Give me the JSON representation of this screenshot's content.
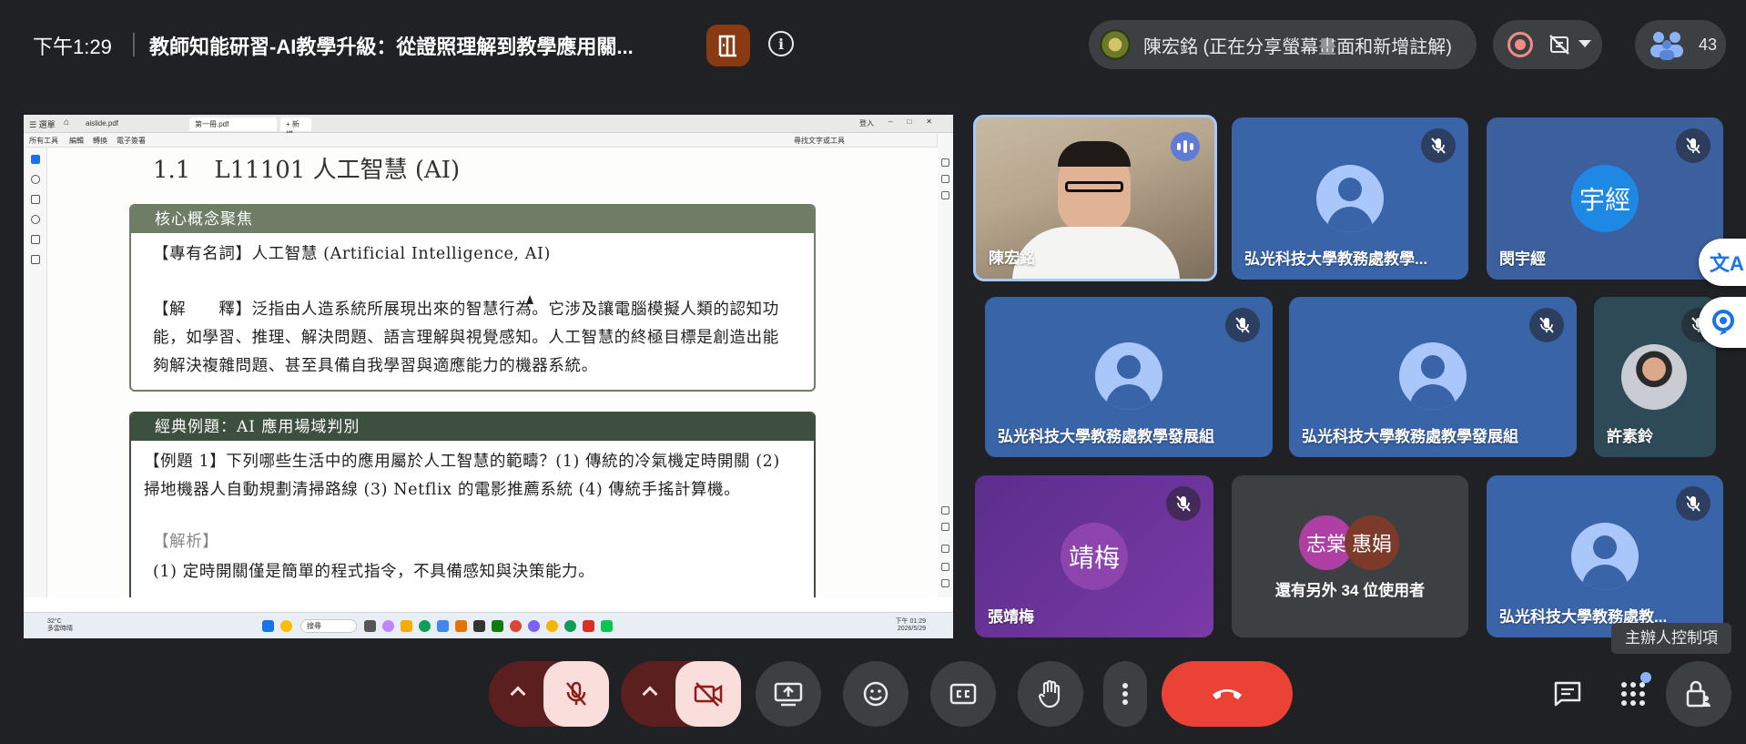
{
  "header": {
    "time": "下午1:29",
    "meeting_title": "教師知能研習-AI教學升級：從證照理解到教學應用關...",
    "presenter_status": "陳宏銘 (正在分享螢幕畫面和新增註解)",
    "participant_count": "43"
  },
  "shared_screen": {
    "window_tabs": [
      "aislide.pdf",
      "第一冊.pdf",
      "+ 新增"
    ],
    "window_controls": [
      "登入"
    ],
    "menu_items": [
      "所有工具",
      "編輯",
      "轉換",
      "電子簽署"
    ],
    "search_hint": "尋找文字或工具",
    "doc": {
      "heading": "1.1　L11101 人工智慧 (AI)",
      "box1": {
        "title": "核心概念聚焦",
        "term": "【專有名詞】人工智慧 (Artificial Intelligence, AI)",
        "explanation": "【解　　釋】泛指由人造系統所展現出來的智慧行為。它涉及讓電腦模擬人類的認知功能，如學習、推理、解決問題、語言理解與視覺感知。人工智慧的終極目標是創造出能夠解決複雜問題、甚至具備自我學習與適應能力的機器系統。"
      },
      "box2": {
        "title": "經典例題：AI 應用場域判別",
        "question": "【例題 1】下列哪些生活中的應用屬於人工智慧的範疇？(1) 傳統的冷氣機定時開關 (2) 掃地機器人自動規劃清掃路線 (3) Netflix 的電影推薦系統 (4) 傳統手搖計算機。",
        "answer_label": "【解析】",
        "answer_partial": "(1) 定時開關僅是簡單的程式指令，不具備感知與決策能力。"
      }
    },
    "taskbar": {
      "weather_temp": "32°C",
      "weather_desc": "多雲時晴",
      "search": "搜尋",
      "clock_time": "下午 01:29",
      "clock_date": "2026/5/29"
    }
  },
  "participants": {
    "speaker": {
      "name": "陳宏銘"
    },
    "tile_2": {
      "name": "弘光科技大學教務處教學..."
    },
    "tile_3": {
      "name": "閔宇經",
      "initials": "宇經"
    },
    "tile_4": {
      "name": "弘光科技大學教務處教學發展組"
    },
    "tile_5": {
      "name": "弘光科技大學教務處教學發展組"
    },
    "tile_6": {
      "name": "許素鈴"
    },
    "tile_7": {
      "name": "張靖梅",
      "initials": "靖梅"
    },
    "others": {
      "avatar_1": "志棠",
      "avatar_2": "惠娟",
      "label": "還有另外 34 位使用者"
    },
    "tile_9": {
      "name": "弘光科技大學教務處教..."
    }
  },
  "tooltip": "主辦人控制項",
  "colors": {
    "background": "#202124",
    "accent_blue": "#a8c7fa",
    "hangup_red": "#ea4335",
    "muted_red_bg": "#f9dedc"
  }
}
